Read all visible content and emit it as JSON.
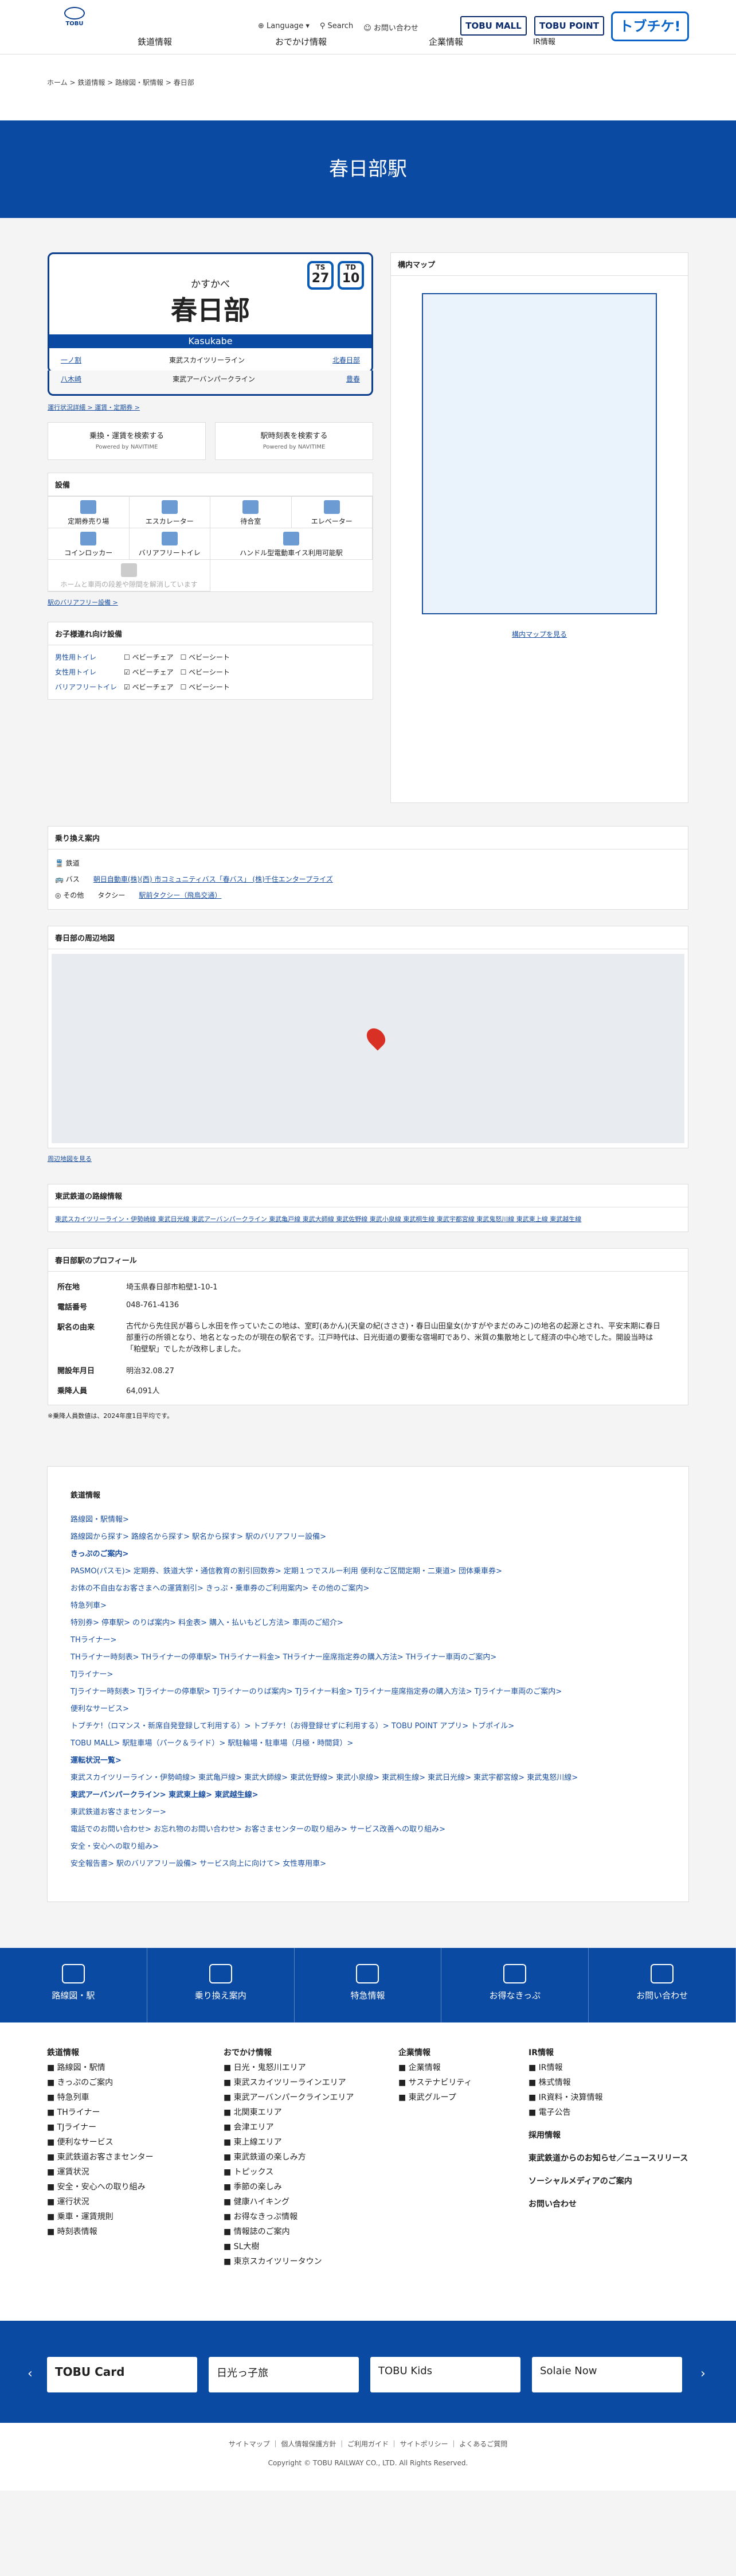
{
  "header": {
    "logo": "TOBU",
    "railway": "鉄道情報",
    "outing": "おでかけ情報",
    "language": "Language",
    "search": "Search",
    "contact": "お問い合わせ",
    "company": "企業情報",
    "ir": "IR情報",
    "mall": "TOBU MALL",
    "point": "TOBU POINT",
    "togo": "トブチケ!"
  },
  "breadcrumb": "ホーム > 鉄道情報 > 路線図・駅情報 > 春日部",
  "page_title": "春日部駅",
  "station": {
    "kana": "かすかべ",
    "name": "春日部",
    "en": "Kasukabe",
    "num1_code": "TS",
    "num1": "27",
    "num2_code": "TD",
    "num2": "10",
    "row1_left": "一ノ割",
    "row1_line": "東武スカイツリーライン",
    "row1_right": "北春日部",
    "row2_left": "八木崎",
    "row2_line": "東武アーバンパークライン",
    "row2_right": "豊春"
  },
  "links_top": "運行状況詳細 >    運賃・定期券 >",
  "search": {
    "a": "乗換・運賃を検索する",
    "b": "駅時刻表を検索する",
    "powered": "Powered by NAVITIME"
  },
  "facilities": {
    "title": "設備",
    "items": [
      "定期券売り場",
      "エスカレーター",
      "待合室",
      "エレベーター",
      "コインロッカー",
      "バリアフリートイレ",
      "ハンドル型電動車イス利用可能駅",
      "ホームと車両の段差や隙間を解消しています"
    ],
    "more": "駅のバリアフリー設備 >"
  },
  "kids": {
    "title": "お子様連れ向け設備",
    "rows": [
      [
        "男性用トイレ",
        "ベビーチェア",
        "ベビーシート"
      ],
      [
        "女性用トイレ",
        "ベビーチェア",
        "ベビーシート"
      ],
      [
        "バリアフリートイレ",
        "ベビーチェア",
        "ベビーシート"
      ]
    ]
  },
  "map": {
    "title": "構内マップ",
    "more": "構内マップを見る"
  },
  "transfer": {
    "title": "乗り換え案内",
    "rail": "鉄道",
    "bus": "バス",
    "bus_links": "朝日自動車(株)(西)    市コミュニティバス「春バス」    (株)千住エンタープライズ",
    "other": "その他",
    "taxi": "タクシー",
    "taxi_link": "駅前タクシー（飛鳥交通）"
  },
  "area": {
    "title": "春日部の周辺地図",
    "more": "周辺地図を見る"
  },
  "lines": {
    "title": "東武鉄道の路線情報",
    "items": "東武スカイツリーライン・伊勢崎線  東武日光線  東武アーバンパークライン  東武亀戸線  東武大師線  東武佐野線  東武小泉線  東武桐生線  東武宇都宮線  東武鬼怒川線  東武東上線  東武越生線"
  },
  "profile": {
    "title": "春日部駅のプロフィール",
    "rows": [
      [
        "所在地",
        "埼玉県春日部市粕壁1-10-1"
      ],
      [
        "電話番号",
        "048-761-4136"
      ],
      [
        "駅名の由来",
        "古代から先住民が暮らし水田を作っていたこの地は、室町(あかん)(天皇の紀(さささ)・春日山田皇女(かすがやまだのみこ)の地名の起源とされ、平安末期に春日部重行の所領となり、地名となったのが現在の駅名です。江戸時代は、日光街道の要衝な宿場町であり、米質の集散地として経済の中心地でした。開設当時は「粕壁駅」でしたが改称しました。"
      ],
      [
        "開設年月日",
        "明治32.08.27"
      ],
      [
        "乗降人員",
        "64,091人"
      ]
    ],
    "note": "※乗降人員数値は、2024年度1日平均です。"
  },
  "sitemap": {
    "title": "鉄道情報",
    "items": [
      "路線図・駅情報>",
      "路線図から探す>  路線名から探す>  駅名から探す>  駅のバリアフリー設備>",
      "きっぷのご案内>",
      "PASMO(パスモ)>  定期券、鉄道大学・通信教育の割引回数券>  定期１つでスルー利用 便利なご区間定期・二東道>  団体乗車券>",
      "お体の不自由なお客さまへの運賃割引>  きっぷ・乗車券のご利用案内>  その他のご案内>",
      "特急列車>",
      "特別券>  停車駅>  のりば案内>  料金表>  購入・払いもどし方法>  車両のご紹介>",
      "THライナー>",
      "THライナー時刻表>  THライナーの停車駅>  THライナー料金>  THライナー座席指定券の購入方法>  THライナー車両のご案内>",
      "TJライナー>",
      "TJライナー時刻表>  TJライナーの停車駅>  TJライナーのりば案内>  TJライナー料金>  TJライナー座席指定券の購入方法>  TJライナー車両のご案内>",
      "便利なサービス>",
      "トブチケ!（ロマンス・新席自発登録して利用する）>  トブチケ!（お得登録せずに利用する）>  TOBU POINT アプリ>  トブポイル>",
      "TOBU MALL>  駅駐車場（パーク＆ライド）>  駅駐輪場・駐車場（月極・時間貸）>",
      "運転状況一覧>",
      "東武スカイツリーライン・伊勢崎線>  東武亀戸線>  東武大師線>  東武佐野線>  東武小泉線>  東武桐生線>  東武日光線>  東武宇都宮線>  東武鬼怒川線>",
      "東武アーバンパークライン>  東武東上線>  東武越生線>",
      "東武鉄道お客さまセンター>",
      "電話でのお問い合わせ>  お忘れ物のお問い合わせ>  お客さまセンターの取り組み>  サービス改善への取り組み>",
      "安全・安心への取り組み>",
      "安全報告書>  駅のバリアフリー設備>  サービス向上に向けて>  女性専用車>"
    ]
  },
  "footnav": [
    "路線図・駅",
    "乗り換え案内",
    "特急情報",
    "お得なきっぷ",
    "お問い合わせ"
  ],
  "footcols": {
    "c1": {
      "title": "鉄道情報",
      "items": [
        "路線図・駅情",
        "きっぷのご案内",
        "特急列車",
        "THライナー",
        "TJライナー",
        "便利なサービス",
        "東武鉄道お客さまセンター",
        "運賃状況",
        "安全・安心への取り組み",
        "運行状況",
        "乗車・運賃規則",
        "時刻表情報"
      ]
    },
    "c2": {
      "title": "おでかけ情報",
      "items": [
        "日光・鬼怒川エリア",
        "東武スカイツリーラインエリア",
        "東武アーバンパークラインエリア",
        "北関東エリア",
        "会津エリア",
        "東上線エリア",
        "東武鉄道の楽しみ方",
        "トピックス",
        "季節の楽しみ",
        "健康ハイキング",
        "お得なきっぷ情報",
        "情報誌のご案内",
        "SL大樹",
        "東京スカイツリータウン"
      ]
    },
    "c3": {
      "title": "企業情報",
      "items": [
        "企業情報",
        "サステナビリティ",
        "東武グループ"
      ]
    },
    "c4": {
      "title": "IR情報",
      "items": [
        "IR情報",
        "株式情報",
        "IR資料・決算情報",
        "電子公告"
      ],
      "extra": [
        "採用情報",
        "東武鉄道からのお知らせ／ニュースリリース",
        "ソーシャルメディアのご案内",
        "お問い合わせ"
      ]
    }
  },
  "banners": [
    "TOBU Card",
    "日光っ子旅",
    "TOBU Kids",
    "Solaie Now"
  ],
  "copyright": {
    "links": "サイトマップ ｜ 個人情報保護方針 ｜ ご利用ガイド ｜ サイトポリシー ｜ よくあるご質問",
    "text": "Copyright © TOBU RAILWAY CO., LTD. All Rights Reserved."
  }
}
